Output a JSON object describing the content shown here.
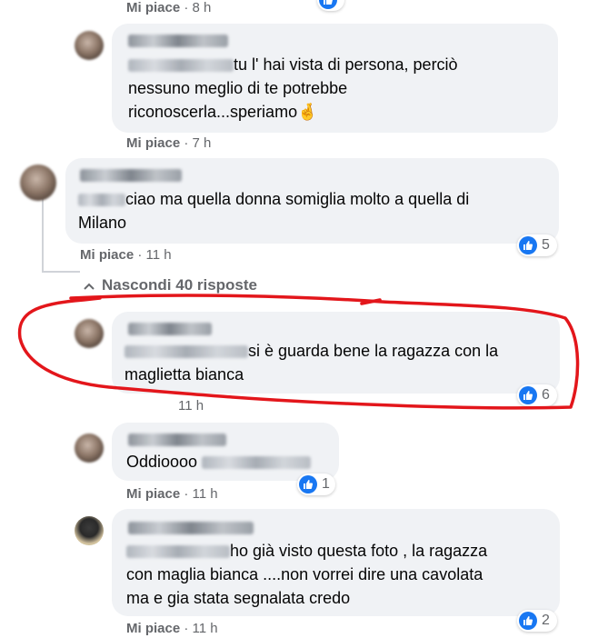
{
  "comments": [
    {
      "id": "c0",
      "like_label": "Mi piace",
      "time": "8 h"
    },
    {
      "id": "c1",
      "line1": "tu l' hai vista di persona, perciò",
      "line2": "nessuno meglio di te potrebbe",
      "line3": "riconoscerla...speriamo",
      "emoji": "🤞",
      "like_label": "Mi piace",
      "time": "7 h"
    },
    {
      "id": "c2",
      "line1": "ciao ma quella donna somiglia molto a quella di",
      "line2": "Milano",
      "like_label": "Mi piace",
      "time": "11 h",
      "reactions": "5"
    },
    {
      "id": "replies",
      "toggle_label": "Nascondi 40 risposte"
    },
    {
      "id": "c3",
      "line1": "si è guarda bene la ragazza con la",
      "line2": "maglietta bianca",
      "time": "11 h",
      "reactions": "6"
    },
    {
      "id": "c4",
      "line1": "Oddioooo",
      "like_label": "Mi piace",
      "time": "11 h",
      "reactions": "1"
    },
    {
      "id": "c5",
      "line1": "ho già visto questa foto , la ragazza",
      "line2": "con maglia bianca ....non vorrei dire una cavolata",
      "line3": "ma e gia stata segnalata credo",
      "like_label": "Mi piace",
      "time": "11 h",
      "reactions": "2"
    }
  ],
  "separator": "·",
  "colors": {
    "bubble": "#f0f2f5",
    "like_blue": "#1877f2",
    "meta_gray": "#65676b",
    "annotation_red": "#e3161b"
  }
}
